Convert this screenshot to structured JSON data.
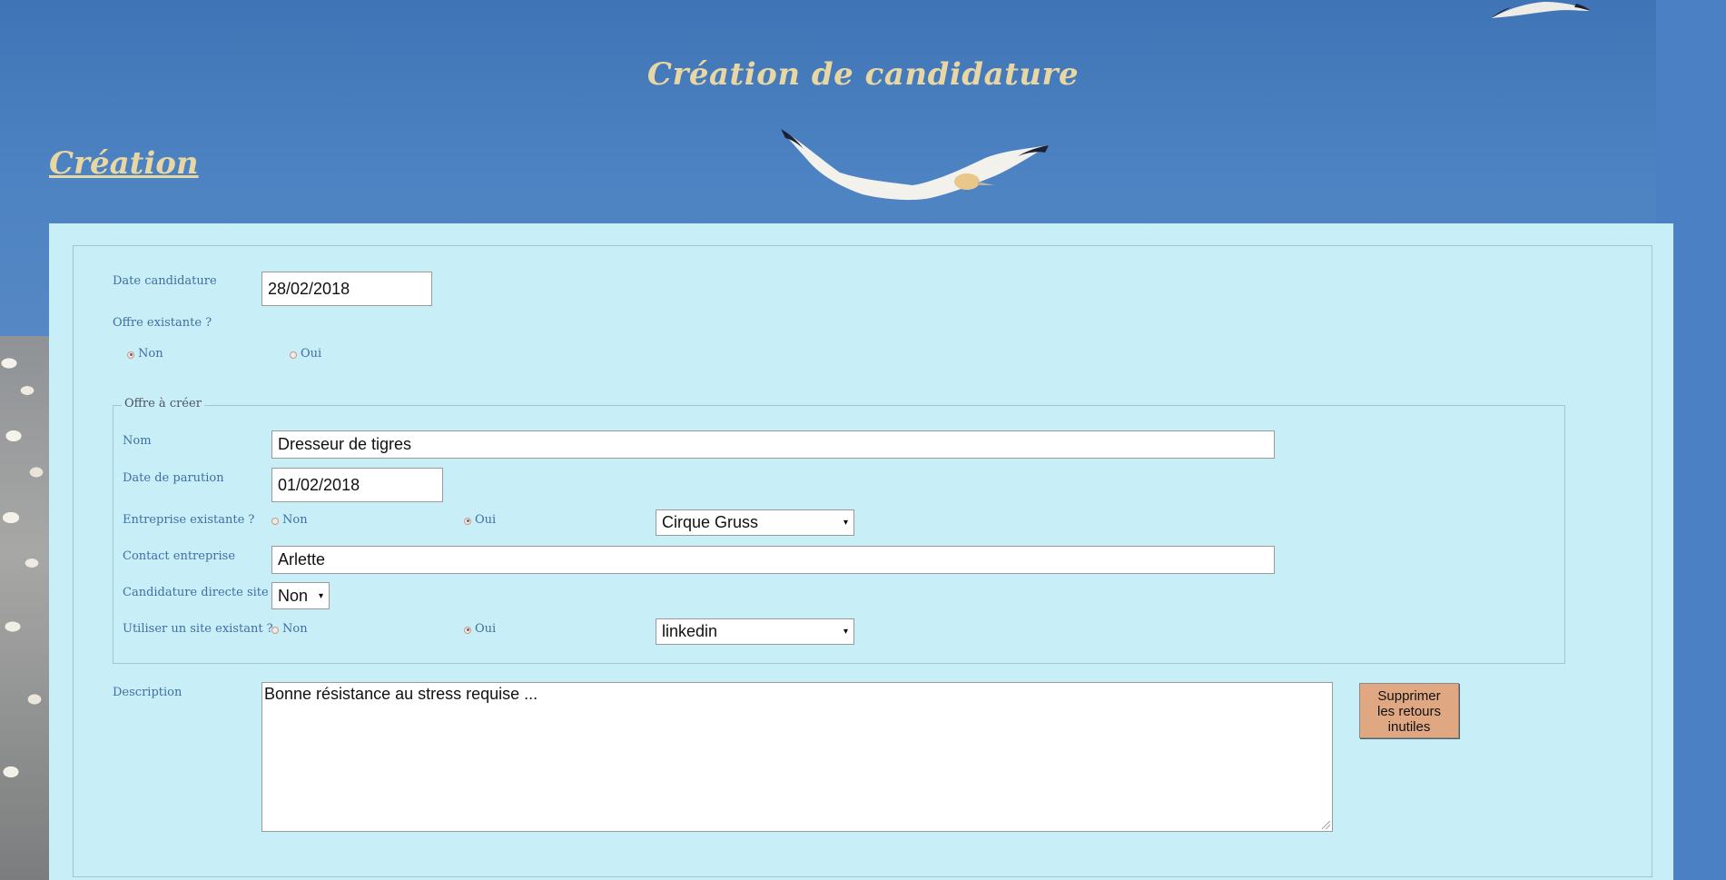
{
  "header": {
    "title": "Création de candidature",
    "section_link": "Création"
  },
  "form": {
    "date_candidature": {
      "label": "Date candidature",
      "value": "28/02/2018"
    },
    "offre_existante": {
      "label": "Offre existante ?",
      "options": [
        {
          "label": "Non",
          "checked": true
        },
        {
          "label": "Oui",
          "checked": false
        }
      ]
    },
    "offre_a_creer": {
      "legend": "Offre à créer",
      "nom": {
        "label": "Nom",
        "value": "Dresseur de tigres"
      },
      "date_parution": {
        "label": "Date de parution",
        "value": "01/02/2018"
      },
      "entreprise_existante": {
        "label": "Entreprise existante ?",
        "options": [
          {
            "label": "Non",
            "checked": false
          },
          {
            "label": "Oui",
            "checked": true
          }
        ],
        "selected": "Cirque Gruss"
      },
      "contact_entreprise": {
        "label": "Contact entreprise",
        "value": "Arlette"
      },
      "candidature_directe": {
        "label": "Candidature directe site",
        "selected": "Non"
      },
      "site_existant": {
        "label": "Utiliser un site existant ?",
        "options": [
          {
            "label": "Non",
            "checked": false
          },
          {
            "label": "Oui",
            "checked": true
          }
        ],
        "selected": "linkedin"
      }
    },
    "description": {
      "label": "Description",
      "value": "Bonne résistance au stress requise ..."
    },
    "remove_returns_button": "Supprimer\nles retours\ninutiles"
  },
  "icons": {
    "select_arrow": "▾"
  },
  "colors": {
    "title": "#e8d7a2",
    "panel": "#c8eef7",
    "label": "#3f6fa3",
    "button": "#e0a882"
  }
}
